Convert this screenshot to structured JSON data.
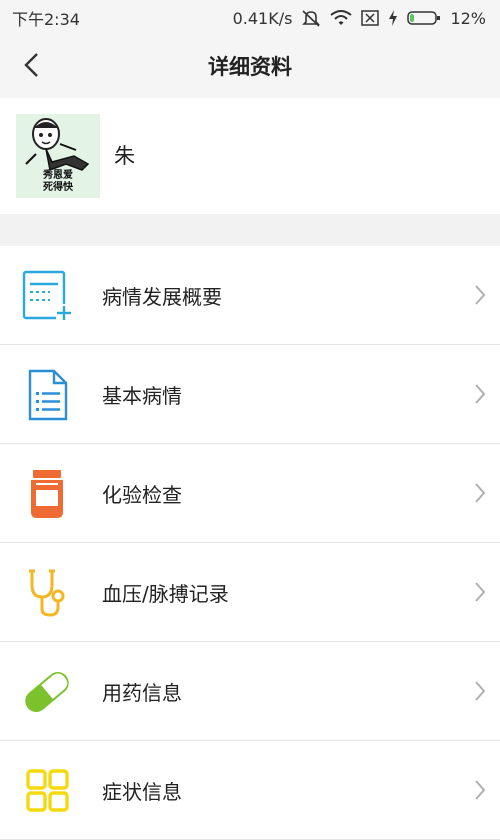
{
  "status_bar": {
    "time": "下午2:34",
    "speed": "0.41K/s",
    "battery": "12%",
    "icons": [
      "mute-icon",
      "wifi-icon",
      "sim-icon",
      "charging-icon",
      "battery-icon"
    ]
  },
  "header": {
    "title": "详细资料",
    "back_icon": "chevron-left-icon"
  },
  "profile": {
    "name": "朱",
    "avatar_caption": "秀恩爱\n死得快"
  },
  "menu": {
    "items": [
      {
        "label": "病情发展概要",
        "icon": "document-add-icon",
        "color": "#2aa8e0"
      },
      {
        "label": "基本病情",
        "icon": "file-list-icon",
        "color": "#2a8fd6"
      },
      {
        "label": "化验检查",
        "icon": "specimen-jar-icon",
        "color": "#ee6b33"
      },
      {
        "label": "血压/脉搏记录",
        "icon": "stethoscope-icon",
        "color": "#f5b623"
      },
      {
        "label": "用药信息",
        "icon": "pill-icon",
        "color": "#7cc22c"
      },
      {
        "label": "症状信息",
        "icon": "grid-icon",
        "color": "#f5d90f"
      }
    ]
  },
  "colors": {
    "header_bg": "#f5f5f5",
    "divider": "#e6e6e6",
    "chevron": "#b0b0b0"
  }
}
